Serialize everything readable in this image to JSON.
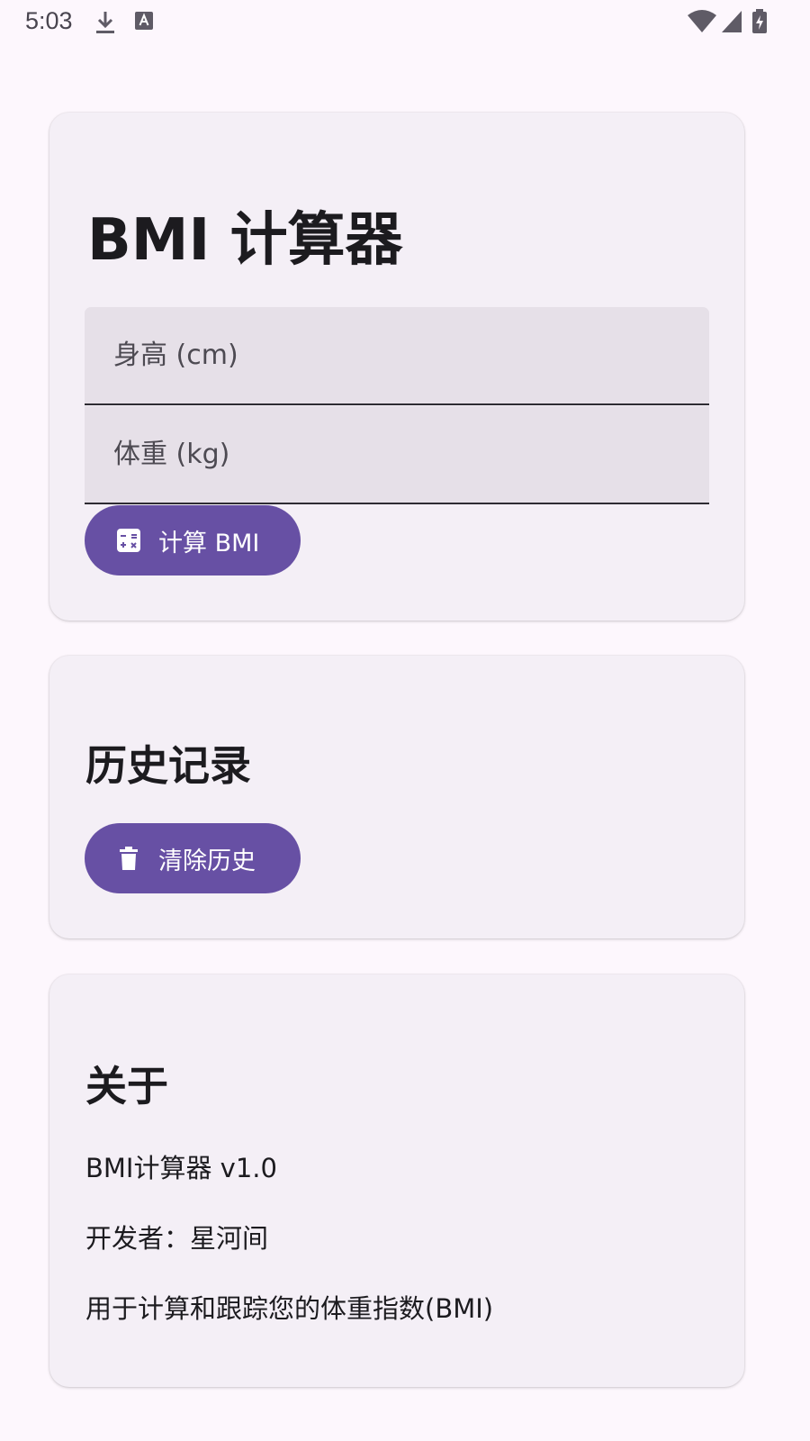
{
  "status_bar": {
    "time": "5:03",
    "left_icons": [
      "download-icon",
      "font-a-icon"
    ],
    "right_icons": [
      "wifi-icon",
      "cell-signal-icon",
      "battery-charging-icon"
    ]
  },
  "calculator": {
    "title": "BMI 计算器",
    "height_field": {
      "placeholder": "身高 (cm)",
      "value": ""
    },
    "weight_field": {
      "placeholder": "体重 (kg)",
      "value": ""
    },
    "calculate_button": {
      "label": "计算 BMI",
      "icon": "calculator-icon"
    }
  },
  "history": {
    "title": "历史记录",
    "clear_button": {
      "label": "清除历史",
      "icon": "trash-icon"
    }
  },
  "about": {
    "title": "关于",
    "version": "BMI计算器 v1.0",
    "developer": "开发者：星河间",
    "description": "用于计算和跟踪您的体重指数(BMI)"
  },
  "colors": {
    "background": "#fdf7fd",
    "card": "#f4eff6",
    "field": "#e6e0e8",
    "accent": "#6750a4",
    "text": "#1c1b1f"
  }
}
